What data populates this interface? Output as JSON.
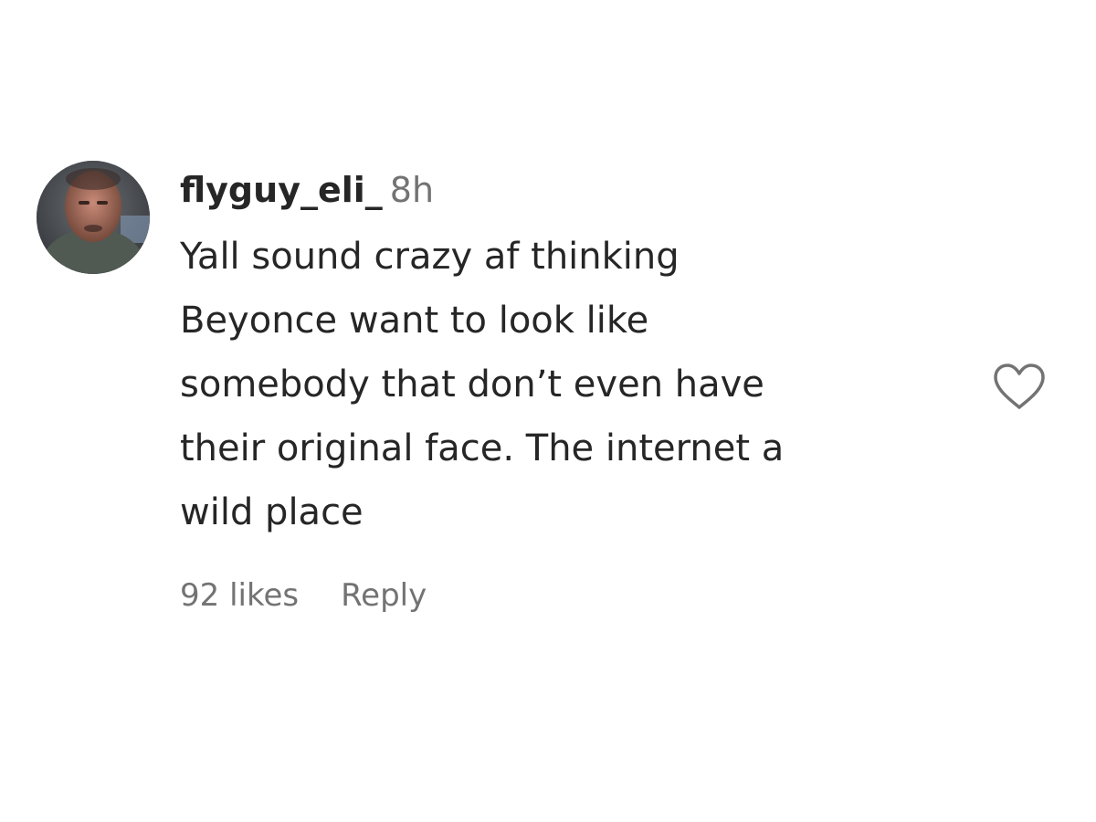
{
  "comment": {
    "username": "flyguy_eli_",
    "time": "8h",
    "text_lines": [
      "Yall sound crazy af thinking",
      "Beyonce want to look like",
      "somebody that don’t even have",
      "their original face. The internet a",
      "wild place"
    ],
    "likes_label": "92 likes",
    "reply_label": "Reply",
    "like_icon": "heart-outline-icon"
  },
  "colors": {
    "text_primary": "#262626",
    "text_secondary": "#737373",
    "background": "#ffffff"
  }
}
